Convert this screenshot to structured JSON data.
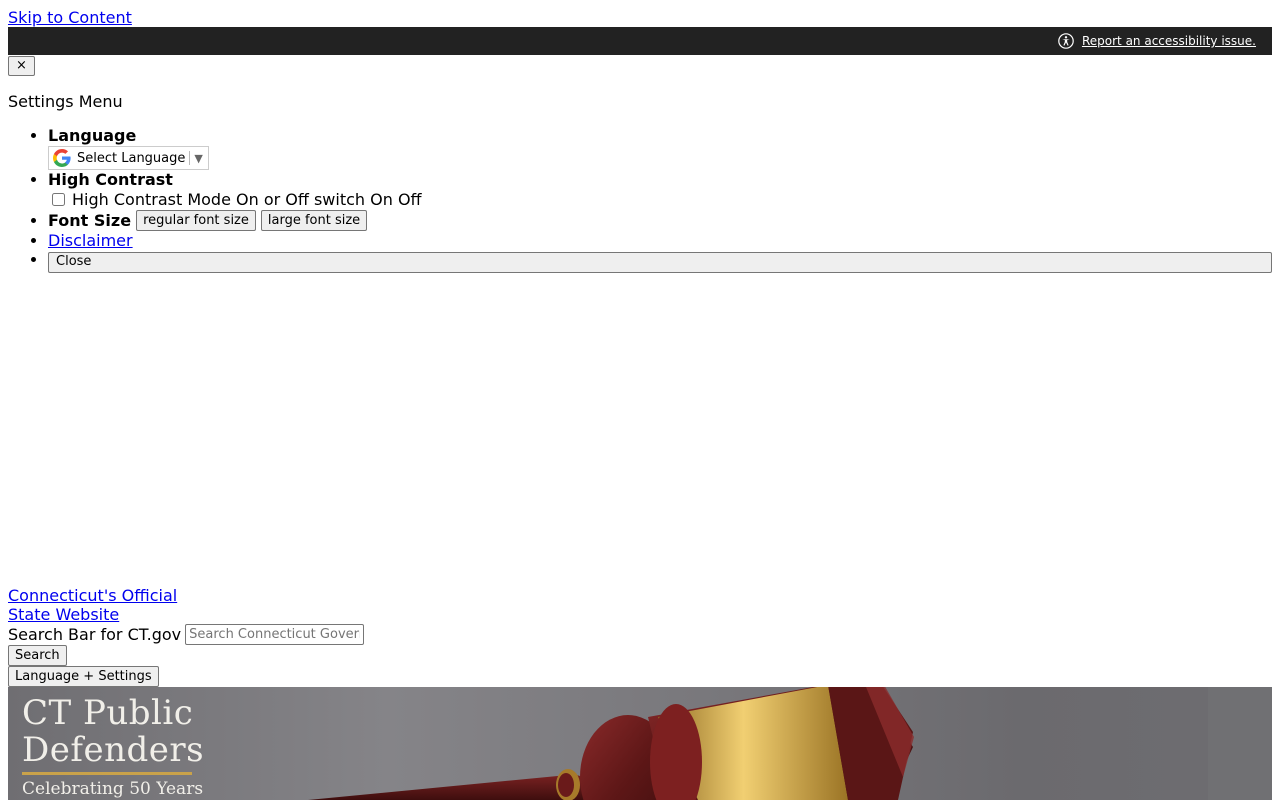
{
  "skip_link": "Skip to Content",
  "accessibility_bar": {
    "icon": "accessibility-icon",
    "report_link": "Report an accessibility issue."
  },
  "settings": {
    "close_x_label": "×",
    "title": "Settings Menu",
    "language": {
      "heading": "Language",
      "select_label": "Select Language",
      "icon": "google-icon"
    },
    "high_contrast": {
      "heading": "High Contrast",
      "checkbox_label": "High Contrast Mode On or Off switch On Off",
      "checked": false
    },
    "font_size": {
      "heading": "Font Size",
      "regular_label": "regular font size",
      "large_label": "large font size"
    },
    "disclaimer_link": "Disclaimer",
    "close_label": "Close"
  },
  "header": {
    "official_line1": "Connecticut's Official",
    "official_line2": "State Website",
    "search_label": "Search Bar for CT.gov",
    "search_placeholder": "Search Connecticut Government",
    "search_button": "Search",
    "language_settings_button": "Language + Settings"
  },
  "banner": {
    "logo_line1": "CT Public",
    "logo_line2": "Defenders",
    "tagline": "Celebrating 50 Years",
    "colors": {
      "background": "#78777b",
      "logo_text": "#f1efe9",
      "gold_rule": "#c9a24a",
      "gavel_wood": "#6b1e1e",
      "gavel_gold": "#c9a24a"
    }
  }
}
